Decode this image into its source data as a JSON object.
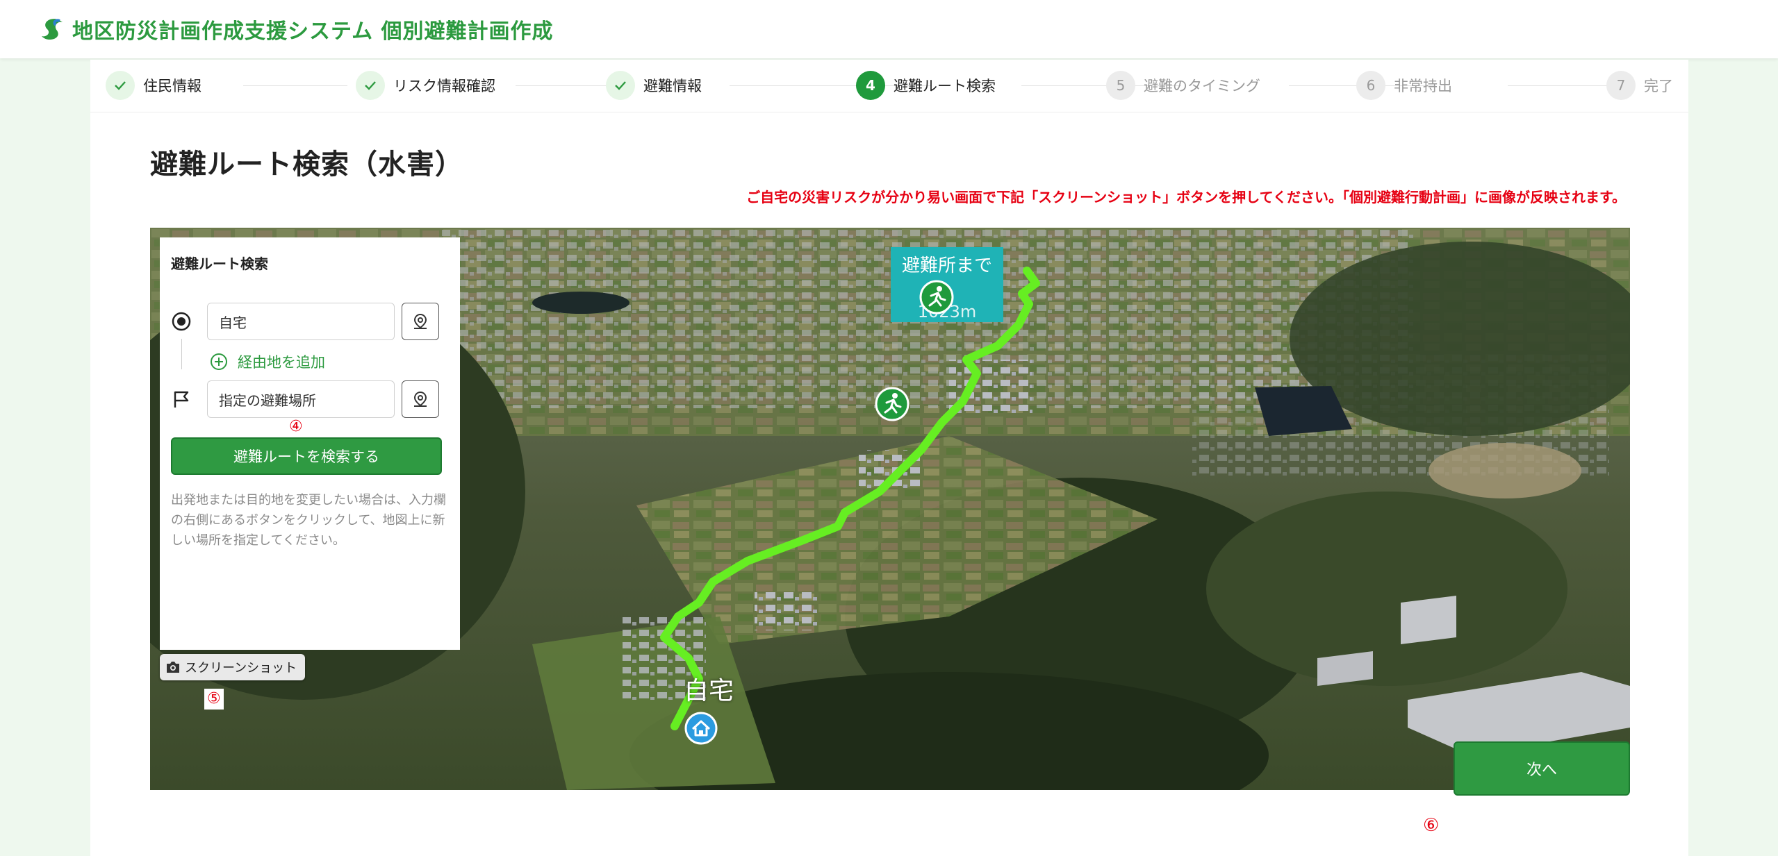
{
  "header": {
    "title": "地区防災計画作成支援システム 個別避難計画作成"
  },
  "stepper": [
    {
      "index": "1",
      "label": "住民情報",
      "state": "done"
    },
    {
      "index": "2",
      "label": "リスク情報確認",
      "state": "done"
    },
    {
      "index": "3",
      "label": "避難情報",
      "state": "done"
    },
    {
      "index": "4",
      "label": "避難ルート検索",
      "state": "active"
    },
    {
      "index": "5",
      "label": "避難のタイミング",
      "state": "todo"
    },
    {
      "index": "6",
      "label": "非常持出",
      "state": "todo"
    },
    {
      "index": "7",
      "label": "完了",
      "state": "todo"
    }
  ],
  "page": {
    "title": "避難ルート検索（水害）",
    "notice": "ご自宅の災害リスクが分かり易い画面で下記「スクリーンショット」ボタンを押してください。「個別避難行動計画」に画像が反映されます。"
  },
  "search_panel": {
    "title": "避難ルート検索",
    "origin_value": "自宅",
    "add_waypoint_label": "経由地を追加",
    "destination_value": "指定の避難場所",
    "marker_4": "④",
    "search_button": "避難ルートを検索する",
    "help_text": "出発地または目的地を変更したい場合は、入力欄の右側にあるボタンをクリックして、地図上に新しい場所を指定してください。"
  },
  "map": {
    "destination_label": "避難所まで",
    "destination_sub": "1023m",
    "home_label": "自宅",
    "screenshot_button": "スクリーンショット",
    "marker_5": "⑤"
  },
  "footer": {
    "marker_6": "⑥",
    "next_button": "次へ"
  },
  "colors": {
    "brand_green": "#2c9a3f",
    "accent_red": "#e60012",
    "route_green": "#66ee22",
    "label_teal": "#1fb3b6"
  }
}
